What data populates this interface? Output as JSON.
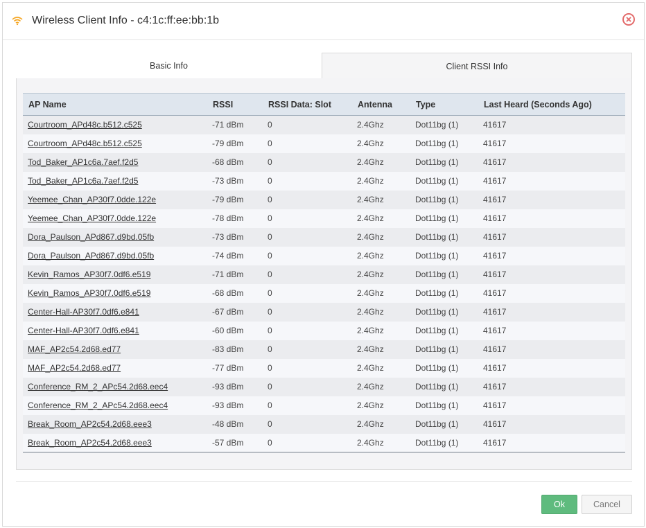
{
  "dialog": {
    "title": "Wireless Client Info - c4:1c:ff:ee:bb:1b",
    "icon": "wifi-icon",
    "close_icon": "close-icon"
  },
  "tabs": [
    {
      "label": "Basic Info",
      "active": false
    },
    {
      "label": "Client RSSI Info",
      "active": true
    }
  ],
  "table": {
    "columns": [
      "AP Name",
      "RSSI",
      "RSSI Data: Slot",
      "Antenna",
      "Type",
      "Last Heard (Seconds Ago)"
    ],
    "rows": [
      [
        "Courtroom_APd48c.b512.c525",
        "-71 dBm",
        "0",
        "2.4Ghz",
        "Dot11bg (1)",
        "41617"
      ],
      [
        "Courtroom_APd48c.b512.c525",
        "-79 dBm",
        "0",
        "2.4Ghz",
        "Dot11bg (1)",
        "41617"
      ],
      [
        "Tod_Baker_AP1c6a.7aef.f2d5",
        "-68 dBm",
        "0",
        "2.4Ghz",
        "Dot11bg (1)",
        "41617"
      ],
      [
        "Tod_Baker_AP1c6a.7aef.f2d5",
        "-73 dBm",
        "0",
        "2.4Ghz",
        "Dot11bg (1)",
        "41617"
      ],
      [
        "Yeemee_Chan_AP30f7.0dde.122e",
        "-79 dBm",
        "0",
        "2.4Ghz",
        "Dot11bg (1)",
        "41617"
      ],
      [
        "Yeemee_Chan_AP30f7.0dde.122e",
        "-78 dBm",
        "0",
        "2.4Ghz",
        "Dot11bg (1)",
        "41617"
      ],
      [
        "Dora_Paulson_APd867.d9bd.05fb",
        "-73 dBm",
        "0",
        "2.4Ghz",
        "Dot11bg (1)",
        "41617"
      ],
      [
        "Dora_Paulson_APd867.d9bd.05fb",
        "-74 dBm",
        "0",
        "2.4Ghz",
        "Dot11bg (1)",
        "41617"
      ],
      [
        "Kevin_Ramos_AP30f7.0df6.e519",
        "-71 dBm",
        "0",
        "2.4Ghz",
        "Dot11bg (1)",
        "41617"
      ],
      [
        "Kevin_Ramos_AP30f7.0df6.e519",
        "-68 dBm",
        "0",
        "2.4Ghz",
        "Dot11bg (1)",
        "41617"
      ],
      [
        "Center-Hall-AP30f7.0df6.e841",
        "-67 dBm",
        "0",
        "2.4Ghz",
        "Dot11bg (1)",
        "41617"
      ],
      [
        "Center-Hall-AP30f7.0df6.e841",
        "-60 dBm",
        "0",
        "2.4Ghz",
        "Dot11bg (1)",
        "41617"
      ],
      [
        "MAF_AP2c54.2d68.ed77",
        "-83 dBm",
        "0",
        "2.4Ghz",
        "Dot11bg (1)",
        "41617"
      ],
      [
        "MAF_AP2c54.2d68.ed77",
        "-77 dBm",
        "0",
        "2.4Ghz",
        "Dot11bg (1)",
        "41617"
      ],
      [
        "Conference_RM_2_APc54.2d68.eec4",
        "-93 dBm",
        "0",
        "2.4Ghz",
        "Dot11bg (1)",
        "41617"
      ],
      [
        "Conference_RM_2_APc54.2d68.eec4",
        "-93 dBm",
        "0",
        "2.4Ghz",
        "Dot11bg (1)",
        "41617"
      ],
      [
        "Break_Room_AP2c54.2d68.eee3",
        "-48 dBm",
        "0",
        "2.4Ghz",
        "Dot11bg (1)",
        "41617"
      ],
      [
        "Break_Room_AP2c54.2d68.eee3",
        "-57 dBm",
        "0",
        "2.4Ghz",
        "Dot11bg (1)",
        "41617"
      ]
    ]
  },
  "footer": {
    "ok_label": "Ok",
    "cancel_label": "Cancel"
  },
  "colors": {
    "accent_icon": "#f5a623",
    "ok_button": "#5fbb7e",
    "close_icon": "#e36b6b"
  }
}
